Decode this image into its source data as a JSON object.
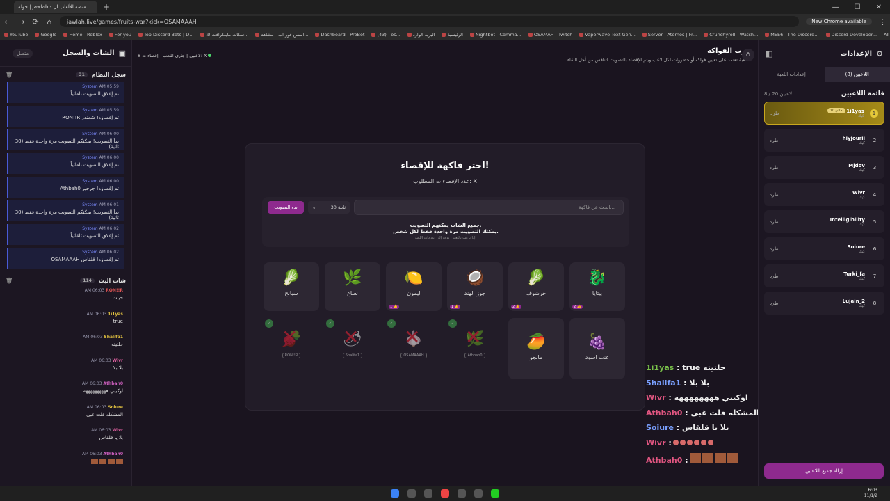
{
  "browser": {
    "tab_title": "جولة | Jawlah - منصة الألعاب ال...",
    "url": "jawlah.live/games/fruits-war?kick=OSAMAAAH",
    "update": "New Chrome available",
    "bookmarks": [
      "YouTube",
      "Google",
      "Home - Roblox",
      "For you",
      "Top Discord Bots | D...",
      "سكات ماينكرافت للا...",
      "اسس فور اب - مشاهد...",
      "Dashboard - ProBot",
      "(43) - os...",
      "البريد الوارد",
      "الرئيسية",
      "Nightbot - Comma...",
      "OSAMAH - Twitch",
      "Vaporwave Text Gen...",
      "Server | Aternos | Fr...",
      "Crunchyroll - Watch...",
      "MEE6 - The Discord...",
      "Discord Developer..."
    ],
    "all_bookmarks": "All Bookmarks"
  },
  "left": {
    "title": "الشات والسجل",
    "online": "متصل",
    "syslog_title": "سجل النظام",
    "syslog_count": "31",
    "syslog": [
      {
        "time": "AM 05:59",
        "author": "System",
        "text": "تم إغلاق التصويت تلقائياً"
      },
      {
        "time": "AM 05:59",
        "author": "System",
        "text": "RON!!R تم إقصاؤه! شمندر"
      },
      {
        "time": "AM 06:00",
        "author": "System",
        "text": "بدأ التصويت! يمكنكم التصويت مرة واحدة فقط (30 ثانية)"
      },
      {
        "time": "AM 06:00",
        "author": "System",
        "text": "تم إغلاق التصويت تلقائياً"
      },
      {
        "time": "AM 06:00",
        "author": "System",
        "text": "Athbah0 تم إقصاؤه! جرجير"
      },
      {
        "time": "AM 06:01",
        "author": "System",
        "text": "بدأ التصويت! يمكنكم التصويت مرة واحدة فقط (30 ثانية)"
      },
      {
        "time": "AM 06:02",
        "author": "System",
        "text": "تم إغلاق التصويت تلقائياً"
      },
      {
        "time": "AM 06:02",
        "author": "System",
        "text": "OSAMAAAH تم إقصاؤه! قلقاس"
      }
    ],
    "chat_title": "شات البث",
    "chat_count": "114",
    "chat": [
      {
        "time": "AM 06:03",
        "author": "RON!!R",
        "text": "حيات",
        "color": "#e05555"
      },
      {
        "time": "AM 06:03",
        "author": "1i1yas",
        "text": "true",
        "color": "#e0c040"
      },
      {
        "time": "AM 06:03",
        "author": "5halifa1",
        "text": "حلتيته",
        "color": "#e0c040"
      },
      {
        "time": "AM 06:03",
        "author": "Wivr",
        "text": "بلا بلا",
        "color": "#e060a0"
      },
      {
        "time": "AM 06:03",
        "author": "Athbah0",
        "text": "اوكيبي ههههههههههه",
        "color": "#d060c0"
      },
      {
        "time": "AM 06:03",
        "author": "Soiure",
        "text": "المشكله قلت غبي",
        "color": "#e0c040"
      },
      {
        "time": "AM 06:03",
        "author": "Wivr",
        "text": "بلا يا قلقاس",
        "color": "#e060a0"
      },
      {
        "time": "AM 06:03",
        "author": "Athbah0",
        "text": "",
        "color": "#d060c0"
      }
    ]
  },
  "game": {
    "title": "حرب الفواكه",
    "desc": "اللعبة تعتمد على تعيين فواكه أو خضروات لكل لاعب ويتم الإقصاء بالتصويت لتنافس من أجل البقاء!",
    "status": "8 لاعبين | جاري اللعب - إقصاءات: X",
    "card_title": "اختر فاكهة للإقصاء!",
    "card_sub": "عدد الإقصاءات المطلوب: X",
    "search_placeholder": "ابحث عن فاكهة...",
    "time_value": "30 ثانية",
    "vote_button": "بدء التصويت",
    "note1": "جميع الشات يمكنهم التصويت.",
    "note2": "يمكنك التصويت مرة واحدة فقط لكل شخص.",
    "note3": "إذا ترغب بالتغيير، توجه إلى إعدادات اللعبة.",
    "fruits": [
      {
        "label": "بيتايا",
        "icon": "🐉",
        "votes": "2"
      },
      {
        "label": "خرشوف",
        "icon": "🥬",
        "votes": "2"
      },
      {
        "label": "جوز الهند",
        "icon": "🥥",
        "votes": "1"
      },
      {
        "label": "ليمون",
        "icon": "🍋",
        "votes": "1"
      },
      {
        "label": "نعناع",
        "icon": "🌿",
        "votes": ""
      },
      {
        "label": "سبانخ",
        "icon": "🥬",
        "votes": ""
      },
      {
        "label": "عنب اسود",
        "icon": "🍇",
        "votes": ""
      },
      {
        "label": "مانجو",
        "icon": "🥭",
        "votes": ""
      }
    ],
    "eliminated": [
      {
        "who": "Athbah0",
        "icon": "🌿"
      },
      {
        "who": "OSAMAAAH",
        "icon": "🧄"
      },
      {
        "who": "5halifa1",
        "icon": "🌶"
      },
      {
        "who": "RON!!R",
        "icon": "🫜"
      }
    ]
  },
  "right": {
    "title": "الإعدادات",
    "tab_players": "اللاعبين (8)",
    "tab_settings": "إعدادات اللعبة",
    "list_title": "قائمة اللاعبين",
    "list_count": "8 / 20 لاعبين",
    "kick": "طرد",
    "status": "كيك",
    "host_badge": "★ مالي",
    "kick_all": "إزالة جميع اللاعبين",
    "players": [
      {
        "name": "1i1yas",
        "num": "1"
      },
      {
        "name": "hiyjourii",
        "num": "2"
      },
      {
        "name": "Mjdov",
        "num": "3"
      },
      {
        "name": "Wivr",
        "num": "4"
      },
      {
        "name": "Intelligibility",
        "num": "5"
      },
      {
        "name": "Soiure",
        "num": "6"
      },
      {
        "name": "Turki_fa",
        "num": "7"
      },
      {
        "name": "Lujain_2",
        "num": "8"
      }
    ]
  },
  "overlay": [
    {
      "name": "1i1yas",
      "text": ": true حلتيته",
      "color": "#7ac24a"
    },
    {
      "name": "5halifa1",
      "text": ": بلا بلا",
      "color": "#7aa0ff"
    },
    {
      "name": "Wivr",
      "text": ": اوكيبي ههههههههه",
      "color": "#e05580"
    },
    {
      "name": "Athbah0",
      "text": ": المشكله قلت غبي",
      "color": "#e05580"
    },
    {
      "name": "Soiure",
      "text": ": بلا يا قلقاس",
      "color": "#7aa0ff"
    },
    {
      "name": "Wivr",
      "text": ":",
      "color": "#e05580"
    },
    {
      "name": "Athbah0",
      "text": ":",
      "color": "#e05580"
    }
  ],
  "clock": {
    "time": "6:03",
    "date": "11/1/2"
  }
}
